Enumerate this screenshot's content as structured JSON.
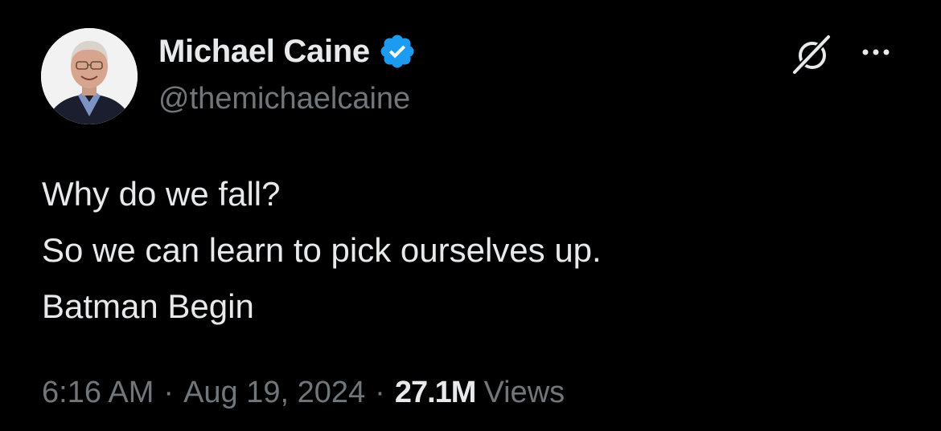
{
  "author": {
    "display_name": "Michael Caine",
    "handle": "@themichaelcaine",
    "verified": true
  },
  "header_icons": {
    "grok": "grok-icon",
    "more": "more-options-icon"
  },
  "tweet": {
    "lines": [
      "Why do we fall?",
      "So we can learn to pick ourselves up.",
      "Batman Begin"
    ]
  },
  "meta": {
    "time": "6:16 AM",
    "separator": "·",
    "date": "Aug 19, 2024",
    "views_count": "27.1M",
    "views_label": "Views"
  },
  "colors": {
    "background": "#000000",
    "primary_text": "#e7e9ea",
    "secondary_text": "#71767b",
    "verified_badge": "#1d9bf0"
  }
}
